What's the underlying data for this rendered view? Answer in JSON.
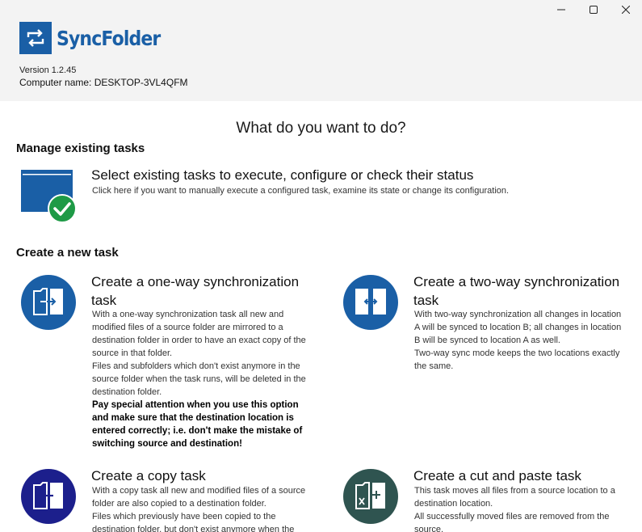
{
  "app": {
    "name": "SyncFolder",
    "version": "Version 1.2.45",
    "computer_name": "Computer name: DESKTOP-3VL4QFM"
  },
  "window_controls": [
    "minimize-icon",
    "maximize-icon",
    "close-icon"
  ],
  "main": {
    "title": "What do you want to do?",
    "manage_section": "Manage existing tasks",
    "manage": {
      "title": "Select existing tasks to execute, configure or check their status",
      "description": "Click here if you want to manually execute a configured task, examine its state or change its configuration."
    },
    "create_section": "Create a new task",
    "tasks": [
      {
        "title": "Create a one-way synchronization task",
        "icon": "one-way-sync-icon",
        "color": "#1a5fa6",
        "paragraphs": [
          "With a one-way synchronization task all new and modified files of a source folder are mirrored to a destination folder in order to have an exact copy of the source in that folder.",
          "Files and subfolders which don't exist anymore in the source folder when the task runs, will be deleted in the destination folder."
        ],
        "warning": "Pay special attention when you use this option and make sure that the destination location is entered correctly; i.e. don't make the mistake of switching source and destination!"
      },
      {
        "title": "Create a two-way synchronization task",
        "icon": "two-way-sync-icon",
        "color": "#1a5fa6",
        "paragraphs": [
          "With two-way synchronization all changes in location A will be synced to location B; all changes in location B will be synced to location A as well.",
          "Two-way sync mode keeps the two locations exactly the same."
        ]
      },
      {
        "title": "Create a copy task",
        "icon": "copy-task-icon",
        "color": "#1c1f8c",
        "paragraphs": [
          "With a copy task all new and modified files of a source folder are also copied to a destination folder.",
          "Files which previously have been copied to the destination folder, but don't exist anymore when the"
        ]
      },
      {
        "title": "Create a cut and paste task",
        "icon": "cut-paste-task-icon",
        "color": "#2f5450",
        "paragraphs": [
          "This task moves all files from a source location to a destination location.",
          "All successfully moved files are removed from the source."
        ]
      }
    ]
  }
}
